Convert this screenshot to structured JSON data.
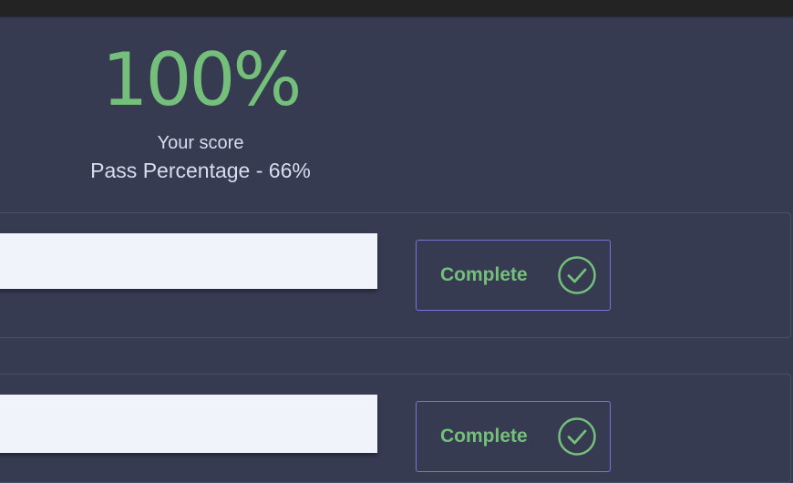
{
  "score": {
    "value": "100%",
    "label": "Your score",
    "pass_percentage": "Pass Percentage - 66%"
  },
  "results": [
    {
      "status": "Complete",
      "icon": "check-circle-icon"
    },
    {
      "status": "Complete",
      "icon": "check-circle-icon"
    }
  ],
  "colors": {
    "background": "#363b52",
    "accent_green": "#74c07a",
    "box_border": "#7a72d6",
    "field": "#f1f3fb"
  }
}
